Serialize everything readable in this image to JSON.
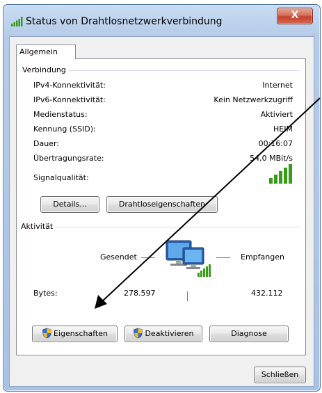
{
  "window": {
    "title": "Status von Drahtlosnetzwerkverbindung",
    "close_label": "X",
    "tab_label": "Allgemein"
  },
  "verbindung": {
    "group_title": "Verbindung",
    "rows": [
      {
        "label": "IPv4-Konnektivität:",
        "value": "Internet"
      },
      {
        "label": "IPv6-Konnektivität:",
        "value": "Kein Netzwerkzugriff"
      },
      {
        "label": "Medienstatus:",
        "value": "Aktiviert"
      },
      {
        "label": "Kennung (SSID):",
        "value": "HEIM"
      },
      {
        "label": "Dauer:",
        "value": "00:16:07"
      },
      {
        "label": "Übertragungsrate:",
        "value": "54,0 MBit/s"
      }
    ],
    "signal_label": "Signalqualität:",
    "signal_bars_lit": 5,
    "signal_color": "#3a9a1a",
    "details_button": "Details...",
    "wireless_props_button": "Drahtloseigenschaften"
  },
  "aktivitaet": {
    "group_title": "Aktivität",
    "sent_label": "Gesendet",
    "received_label": "Empfangen",
    "bytes_label": "Bytes:",
    "bytes_sent": "278.597",
    "bytes_received": "432.112"
  },
  "actions": {
    "properties_button": "Eigenschaften",
    "disable_button": "Deaktivieren",
    "diagnose_button": "Diagnose"
  },
  "footer": {
    "close_button": "Schließen"
  }
}
